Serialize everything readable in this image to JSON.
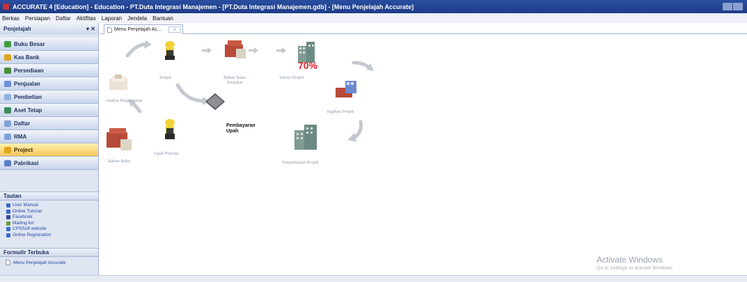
{
  "window": {
    "title": "ACCURATE 4 [Education] - Education - PT.Duta Integrasi Manajemen - [PT.Duta Integrasi Manajemen.gdb] - [Menu Penjelajah Accurate]"
  },
  "menu": [
    "Berkas",
    "Persiapan",
    "Daftar",
    "Aktifitas",
    "Laporan",
    "Jendela",
    "Bantuan"
  ],
  "sidebar": {
    "title": "Penjelajah",
    "controls": "▾ ✕",
    "items": [
      {
        "label": "Buku Besar",
        "color": "#3e9d3a"
      },
      {
        "label": "Kas Bank",
        "color": "#e0a41c"
      },
      {
        "label": "Persediaan",
        "color": "#4a8f3a"
      },
      {
        "label": "Penjualan",
        "color": "#6a8fd6"
      },
      {
        "label": "Pembelian",
        "color": "#8fb0e0"
      },
      {
        "label": "Aset Tetap",
        "color": "#3a8a5a"
      },
      {
        "label": "Daftar",
        "color": "#7fa0d8"
      },
      {
        "label": "RMA",
        "color": "#7fa0d8"
      },
      {
        "label": "Project",
        "color": "#e0a41c"
      },
      {
        "label": "Pabrikasi",
        "color": "#5a7fc8"
      }
    ],
    "active_item": "Project",
    "links_title": "Tautan",
    "links": [
      {
        "label": "User Manual",
        "icon": "globe-icon",
        "color": "#3a6ad0"
      },
      {
        "label": "Online Tutorial",
        "icon": "globe-icon",
        "color": "#3a6ad0"
      },
      {
        "label": "Facebook",
        "icon": "facebook-icon",
        "color": "#2b4b9a"
      },
      {
        "label": "Mailing list",
        "icon": "people-icon",
        "color": "#6a9a3a"
      },
      {
        "label": "CPSSoft website",
        "icon": "globe-icon",
        "color": "#3a6ad0"
      },
      {
        "label": "Online Registration",
        "icon": "globe-icon",
        "color": "#3a6ad0"
      }
    ],
    "forms_title": "Formulir Terbuka",
    "forms": [
      "Menu Penjelajah Accurate"
    ]
  },
  "tab": {
    "label": "Menu Penjelajah Ac...",
    "close": "x"
  },
  "workflow": {
    "projek": "Projek",
    "bahan_baku_terpakai": [
      "Bahan Baku",
      "Terpakai"
    ],
    "survei_projek": "Survei Projek",
    "analisa_harga_kerja": "Analisa Harga Kerja",
    "tagihan_projek": "Tagihan Projek",
    "pembayaran_upah": [
      "Pembayaran",
      "Upah"
    ],
    "bahan_baku": "Bahan Baku",
    "upah_pekerja": "Upah Pekerja",
    "penyelesaian_projek": "Penyelesaian Projek",
    "percent": "70%"
  },
  "watermark": {
    "line1": "Activate Windows",
    "line2": "Go to Settings to activate Windows."
  }
}
